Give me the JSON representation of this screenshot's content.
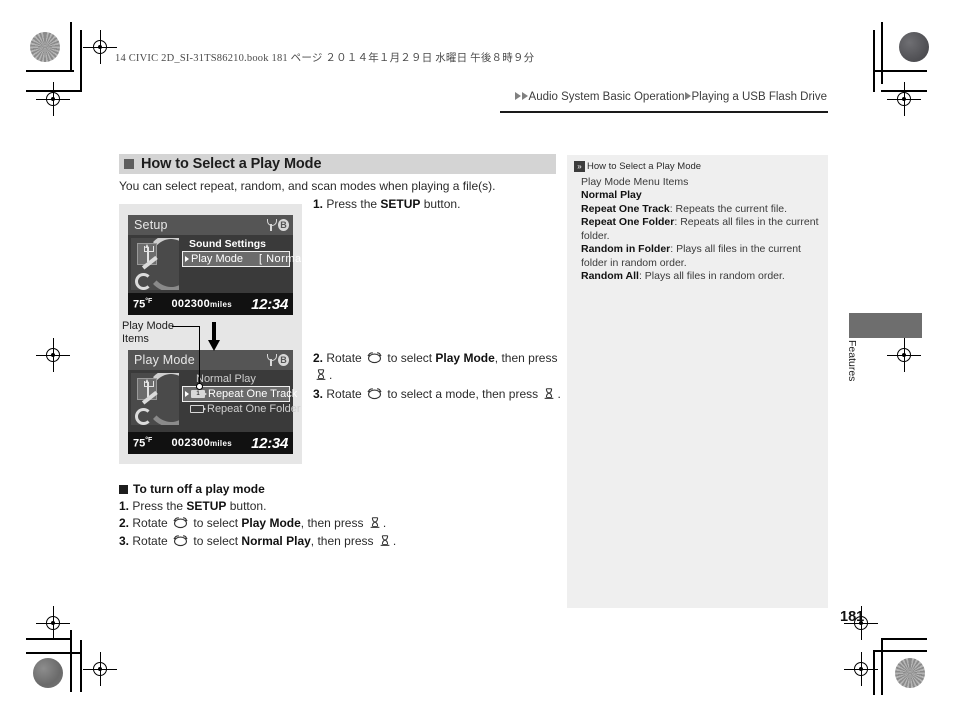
{
  "print": {
    "imprint": "14 CIVIC 2D_SI-31TS86210.book   181 ページ   ２０１４年１月２９日   水曜日   午後８時９分"
  },
  "breadcrumb": {
    "item1": "Audio System Basic Operation",
    "item2": "Playing a USB Flash Drive"
  },
  "section": {
    "title": "How to Select a Play Mode",
    "intro": "You can select repeat, random, and scan modes when playing a file(s)."
  },
  "screens": {
    "setup": {
      "title": "Setup",
      "heading": "Sound Settings",
      "selected_row_label": "Play Mode",
      "selected_row_value": "[ Normal ]",
      "temp": "75",
      "temp_unit": "°F",
      "odometer": "002300",
      "odometer_unit": "miles",
      "clock": "12:34"
    },
    "playmode": {
      "title": "Play Mode",
      "row1": "Normal Play",
      "row2": "Repeat One Track",
      "row2_icon": "1",
      "row3": "Repeat One Folder",
      "row3_icon": "",
      "temp": "75",
      "temp_unit": "°F",
      "odometer": "002300",
      "odometer_unit": "miles",
      "clock": "12:34"
    }
  },
  "callout": {
    "label_line1": "Play Mode",
    "label_line2": "Items"
  },
  "steps": {
    "step1_num": "1.",
    "step1_a": "Press the ",
    "step1_b": "SETUP",
    "step1_c": " button.",
    "step2_num": "2.",
    "step2_a": "Rotate ",
    "step2_b": " to select ",
    "step2_c": "Play Mode",
    "step2_d": ", then press ",
    "step2_e": ".",
    "step3_num": "3.",
    "step3_a": "Rotate ",
    "step3_b": " to select a mode, then press ",
    "step3_c": "."
  },
  "subsection": {
    "title": "To turn off a play mode",
    "b1_num": "1.",
    "b1_a": "Press the ",
    "b1_b": "SETUP",
    "b1_c": " button.",
    "b2_num": "2.",
    "b2_a": "Rotate ",
    "b2_b": " to select ",
    "b2_c": "Play Mode",
    "b2_d": ", then press ",
    "b2_e": ".",
    "b3_num": "3.",
    "b3_a": "Rotate ",
    "b3_b": " to select ",
    "b3_c": "Normal Play",
    "b3_d": ", then press ",
    "b3_e": "."
  },
  "sidebar": {
    "title": "How to Select a Play Mode",
    "marker": "»",
    "subtitle": "Play Mode Menu Items",
    "items": [
      {
        "term": "Normal Play",
        "desc": ""
      },
      {
        "term": "Repeat One Track",
        "desc": ": Repeats the current file."
      },
      {
        "term": "Repeat One Folder",
        "desc": ": Repeats all files in the current folder."
      },
      {
        "term": "Random in Folder",
        "desc": ": Plays all files in the current folder in random order."
      },
      {
        "term": "Random All",
        "desc": ": Plays all files in random order."
      }
    ]
  },
  "tab": {
    "label": "Features"
  },
  "page": {
    "number": "181"
  },
  "colors": {
    "section_head_bg": "#d4d4d4",
    "sidebar_bg": "#efefef",
    "tab_block": "#6e6e6e",
    "screen_bg": "#e6e6e6"
  }
}
